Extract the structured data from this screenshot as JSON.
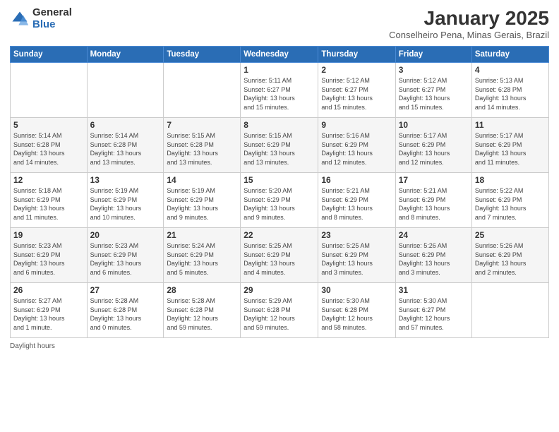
{
  "logo": {
    "general": "General",
    "blue": "Blue"
  },
  "title": "January 2025",
  "subtitle": "Conselheiro Pena, Minas Gerais, Brazil",
  "days_of_week": [
    "Sunday",
    "Monday",
    "Tuesday",
    "Wednesday",
    "Thursday",
    "Friday",
    "Saturday"
  ],
  "weeks": [
    [
      {
        "day": "",
        "info": ""
      },
      {
        "day": "",
        "info": ""
      },
      {
        "day": "",
        "info": ""
      },
      {
        "day": "1",
        "info": "Sunrise: 5:11 AM\nSunset: 6:27 PM\nDaylight: 13 hours\nand 15 minutes."
      },
      {
        "day": "2",
        "info": "Sunrise: 5:12 AM\nSunset: 6:27 PM\nDaylight: 13 hours\nand 15 minutes."
      },
      {
        "day": "3",
        "info": "Sunrise: 5:12 AM\nSunset: 6:27 PM\nDaylight: 13 hours\nand 15 minutes."
      },
      {
        "day": "4",
        "info": "Sunrise: 5:13 AM\nSunset: 6:28 PM\nDaylight: 13 hours\nand 14 minutes."
      }
    ],
    [
      {
        "day": "5",
        "info": "Sunrise: 5:14 AM\nSunset: 6:28 PM\nDaylight: 13 hours\nand 14 minutes."
      },
      {
        "day": "6",
        "info": "Sunrise: 5:14 AM\nSunset: 6:28 PM\nDaylight: 13 hours\nand 13 minutes."
      },
      {
        "day": "7",
        "info": "Sunrise: 5:15 AM\nSunset: 6:28 PM\nDaylight: 13 hours\nand 13 minutes."
      },
      {
        "day": "8",
        "info": "Sunrise: 5:15 AM\nSunset: 6:29 PM\nDaylight: 13 hours\nand 13 minutes."
      },
      {
        "day": "9",
        "info": "Sunrise: 5:16 AM\nSunset: 6:29 PM\nDaylight: 13 hours\nand 12 minutes."
      },
      {
        "day": "10",
        "info": "Sunrise: 5:17 AM\nSunset: 6:29 PM\nDaylight: 13 hours\nand 12 minutes."
      },
      {
        "day": "11",
        "info": "Sunrise: 5:17 AM\nSunset: 6:29 PM\nDaylight: 13 hours\nand 11 minutes."
      }
    ],
    [
      {
        "day": "12",
        "info": "Sunrise: 5:18 AM\nSunset: 6:29 PM\nDaylight: 13 hours\nand 11 minutes."
      },
      {
        "day": "13",
        "info": "Sunrise: 5:19 AM\nSunset: 6:29 PM\nDaylight: 13 hours\nand 10 minutes."
      },
      {
        "day": "14",
        "info": "Sunrise: 5:19 AM\nSunset: 6:29 PM\nDaylight: 13 hours\nand 9 minutes."
      },
      {
        "day": "15",
        "info": "Sunrise: 5:20 AM\nSunset: 6:29 PM\nDaylight: 13 hours\nand 9 minutes."
      },
      {
        "day": "16",
        "info": "Sunrise: 5:21 AM\nSunset: 6:29 PM\nDaylight: 13 hours\nand 8 minutes."
      },
      {
        "day": "17",
        "info": "Sunrise: 5:21 AM\nSunset: 6:29 PM\nDaylight: 13 hours\nand 8 minutes."
      },
      {
        "day": "18",
        "info": "Sunrise: 5:22 AM\nSunset: 6:29 PM\nDaylight: 13 hours\nand 7 minutes."
      }
    ],
    [
      {
        "day": "19",
        "info": "Sunrise: 5:23 AM\nSunset: 6:29 PM\nDaylight: 13 hours\nand 6 minutes."
      },
      {
        "day": "20",
        "info": "Sunrise: 5:23 AM\nSunset: 6:29 PM\nDaylight: 13 hours\nand 6 minutes."
      },
      {
        "day": "21",
        "info": "Sunrise: 5:24 AM\nSunset: 6:29 PM\nDaylight: 13 hours\nand 5 minutes."
      },
      {
        "day": "22",
        "info": "Sunrise: 5:25 AM\nSunset: 6:29 PM\nDaylight: 13 hours\nand 4 minutes."
      },
      {
        "day": "23",
        "info": "Sunrise: 5:25 AM\nSunset: 6:29 PM\nDaylight: 13 hours\nand 3 minutes."
      },
      {
        "day": "24",
        "info": "Sunrise: 5:26 AM\nSunset: 6:29 PM\nDaylight: 13 hours\nand 3 minutes."
      },
      {
        "day": "25",
        "info": "Sunrise: 5:26 AM\nSunset: 6:29 PM\nDaylight: 13 hours\nand 2 minutes."
      }
    ],
    [
      {
        "day": "26",
        "info": "Sunrise: 5:27 AM\nSunset: 6:29 PM\nDaylight: 13 hours\nand 1 minute."
      },
      {
        "day": "27",
        "info": "Sunrise: 5:28 AM\nSunset: 6:28 PM\nDaylight: 13 hours\nand 0 minutes."
      },
      {
        "day": "28",
        "info": "Sunrise: 5:28 AM\nSunset: 6:28 PM\nDaylight: 12 hours\nand 59 minutes."
      },
      {
        "day": "29",
        "info": "Sunrise: 5:29 AM\nSunset: 6:28 PM\nDaylight: 12 hours\nand 59 minutes."
      },
      {
        "day": "30",
        "info": "Sunrise: 5:30 AM\nSunset: 6:28 PM\nDaylight: 12 hours\nand 58 minutes."
      },
      {
        "day": "31",
        "info": "Sunrise: 5:30 AM\nSunset: 6:27 PM\nDaylight: 12 hours\nand 57 minutes."
      },
      {
        "day": "",
        "info": ""
      }
    ]
  ],
  "footer": "Daylight hours"
}
